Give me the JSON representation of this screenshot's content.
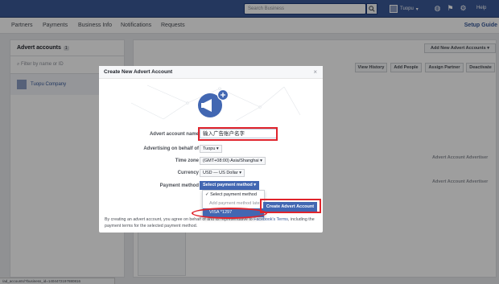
{
  "topbar": {
    "search_placeholder": "Search Business",
    "business_name": "Tuopu",
    "help": "Help"
  },
  "subnav": {
    "items": [
      "Partners",
      "Payments",
      "Business Info",
      "Notifications",
      "Requests"
    ],
    "setup": "Setup Guide"
  },
  "left": {
    "title": "Advert accounts",
    "count": "1",
    "filter_placeholder": "Filter by name or ID",
    "company": "Tuopu Company"
  },
  "right": {
    "add_button": "Add New Advert Accounts",
    "buttons": [
      "View History",
      "Add People",
      "Assign Partner",
      "Deactivate"
    ],
    "advertiser_label": "Advert Account Advertiser"
  },
  "modal": {
    "title": "Create New Advert Account",
    "fields": {
      "name_label": "Advert account name",
      "name_value": "输入广告账户名字",
      "behalf_label": "Advertising on behalf of",
      "behalf_value": "Tuopu",
      "tz_label": "Time zone",
      "tz_value": "(GMT+08:00) Asia/Shanghai",
      "currency_label": "Currency",
      "currency_value": "USD — US Dollar",
      "payment_label": "Payment method",
      "payment_value": "Select payment method"
    },
    "dropdown": {
      "items": [
        "Select payment method",
        "Add payment method later",
        "VISA *1297"
      ]
    },
    "create_button": "Create Advert Account",
    "footer": {
      "text1": "By creating an advert account, you agree on behalf of ",
      "text2": " and its representative to ",
      "link_terms": "Facebook's Terms",
      "text3": ", including the payment terms for the selected payment method."
    }
  },
  "status_url": "/ad_accounts/?business_id=1404472197880816",
  "colors": {
    "brand": "#3b5998",
    "button": "#4267b2",
    "highlight": "#e0242c"
  }
}
